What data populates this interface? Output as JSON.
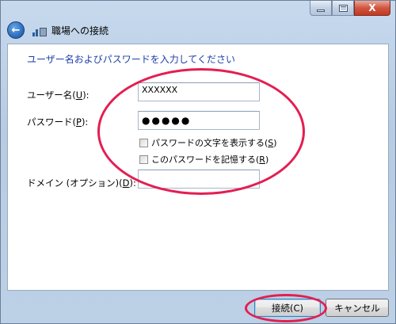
{
  "window": {
    "title": "職場への接続",
    "close_glyph": "X"
  },
  "form": {
    "instruction": "ユーザー名およびパスワードを入力してください",
    "username": {
      "label": "ユーザー名(",
      "mnemonic": "U",
      "label_end": "):",
      "value": "XXXXXX"
    },
    "password": {
      "label": "パスワード(",
      "mnemonic": "P",
      "label_end": "):",
      "value": "●●●●●"
    },
    "show_chars": {
      "label": "パスワードの文字を表示する(",
      "mnemonic": "S",
      "label_end": ")",
      "checked": false
    },
    "remember": {
      "label": "このパスワードを記憶する(",
      "mnemonic": "R",
      "label_end": ")",
      "checked": false
    },
    "domain": {
      "label": "ドメイン (オプション)(",
      "mnemonic": "D",
      "label_end": "):",
      "value": ""
    }
  },
  "buttons": {
    "connect": "接続(C)",
    "cancel": "キャンセル"
  },
  "colors": {
    "instruction": "#1c3ea8",
    "highlight_ellipse": "#e41e51"
  },
  "icons": {
    "back": "back-arrow-icon",
    "network": "network-connection-icon"
  }
}
